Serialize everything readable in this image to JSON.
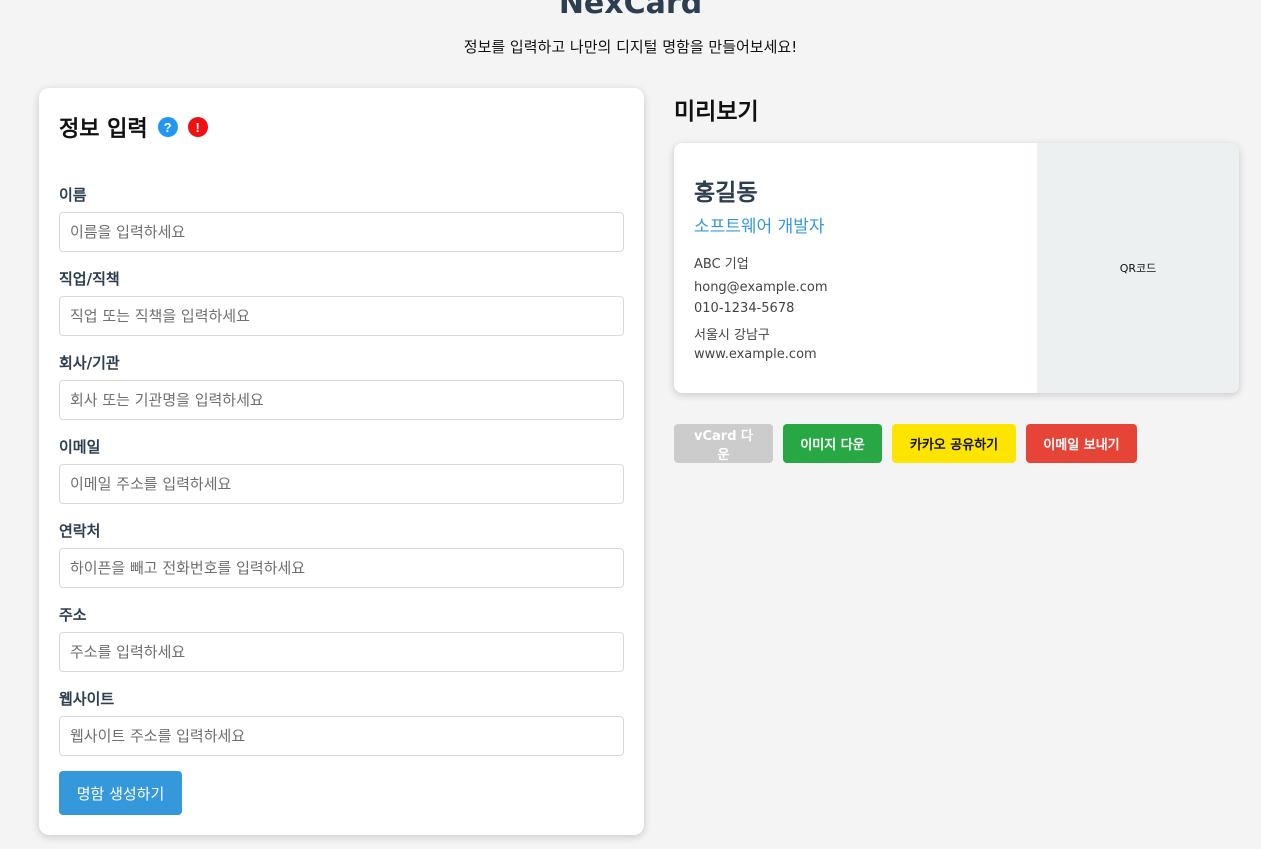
{
  "header": {
    "title": "NexCard",
    "subtitle": "정보를 입력하고 나만의 디지털 명함을 만들어보세요!"
  },
  "form": {
    "heading": "정보 입력",
    "help_badge": "?",
    "alert_badge": "!",
    "fields": [
      {
        "label": "이름",
        "placeholder": "이름을 입력하세요",
        "value": ""
      },
      {
        "label": "직업/직책",
        "placeholder": "직업 또는 직책을 입력하세요",
        "value": ""
      },
      {
        "label": "회사/기관",
        "placeholder": "회사 또는 기관명을 입력하세요",
        "value": ""
      },
      {
        "label": "이메일",
        "placeholder": "이메일 주소를 입력하세요",
        "value": ""
      },
      {
        "label": "연락처",
        "placeholder": "하이픈을 빼고 전화번호를 입력하세요",
        "value": ""
      },
      {
        "label": "주소",
        "placeholder": "주소를 입력하세요",
        "value": ""
      },
      {
        "label": "웹사이트",
        "placeholder": "웹사이트 주소를 입력하세요",
        "value": ""
      }
    ],
    "submit_label": "명함 생성하기"
  },
  "preview": {
    "heading": "미리보기",
    "card": {
      "name": "홍길동",
      "job": "소프트웨어 개발자",
      "company": "ABC 기업",
      "email": "hong@example.com",
      "phone": "010-1234-5678",
      "address": "서울시 강남구",
      "website": "www.example.com",
      "qr_label": "QR코드"
    },
    "actions": {
      "vcard": "vCard 다운",
      "image": "이미지 다운",
      "kakao": "카카오 공유하기",
      "email": "이메일 보내기"
    }
  },
  "colors": {
    "accent": "#3498db",
    "title": "#2c3e50",
    "green": "#27a844",
    "kakao": "#fee500",
    "red": "#e74438",
    "disabled": "#cccccc"
  }
}
